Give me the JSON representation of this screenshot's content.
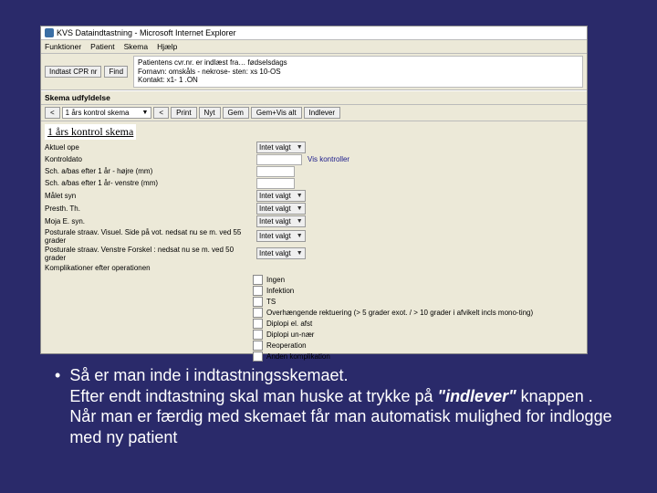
{
  "window": {
    "title": "KVS Dataindtastning - Microsoft Internet Explorer"
  },
  "menu": {
    "funktioner": "Funktioner",
    "patient": "Patient",
    "skema": "Skema",
    "hjaelp": "Hjælp"
  },
  "info": {
    "button1": "Indtast CPR nr",
    "button2": "Find",
    "line1": "Patientens cvr.nr. er indlæst fra… fødselsdags",
    "line2": "Fornavn: omskåls - nekrose- sten: xs 10-OS",
    "line3": "Kontakt: x1- 1 .ON"
  },
  "section": {
    "title": "Skema udfyldelse"
  },
  "toolbar": {
    "dropdown": "1 års kontrol skema",
    "nav_back": "<",
    "print": "Print",
    "nyt": "Nyt",
    "gem": "Gem",
    "gem_vis": "Gem+Vis alt",
    "indlever": "Indlever"
  },
  "form": {
    "title": "1 års kontrol skema",
    "rows": {
      "aktuel_ope": "Aktuel ope",
      "kontroldato": "Kontroldato",
      "note": "Vis kontroller",
      "sch_hojre": "Sch. a/bas efter 1 år - højre (mm)",
      "sch_venstre": "Sch. a/bas efter 1 år- venstre (mm)",
      "malet_syn": "Målet syn",
      "prest_th": "Presth. Th.",
      "moja_syn": "Moja E. syn.",
      "post_hojre": "Posturale straav. Visuel. Side på vot. nedsat nu se m. ved 55 grader",
      "post_venstre": "Posturale straav. Venstre Forskel : nedsat nu se m. ved 50 grader",
      "komplikationer": "Komplikationer efter operationen"
    },
    "select_value": "Intet valgt",
    "checks": {
      "ingen": "Ingen",
      "infektion": "Infektion",
      "ts": "TS",
      "overhangende": "Overhængende rektuering (> 5 grader exot. / > 10 grader i afvikelt incls mono-ting)",
      "diplopi_afst": "Diplopi el. afst",
      "diplopi_unaer": "Diplopi un-nær",
      "reoperation": "Reoperation",
      "anden": "Anden komplikation"
    }
  },
  "bullet": {
    "line1": "Så er man inde i indtastningsskemaet.",
    "line2a": "Efter endt indtastning skal man huske at trykke på ",
    "line2b": "\"indlever\"",
    "line2c": " knappen .",
    "line3": "Når man er færdig med skemaet får man automatisk mulighed for indlogge med ny patient"
  }
}
